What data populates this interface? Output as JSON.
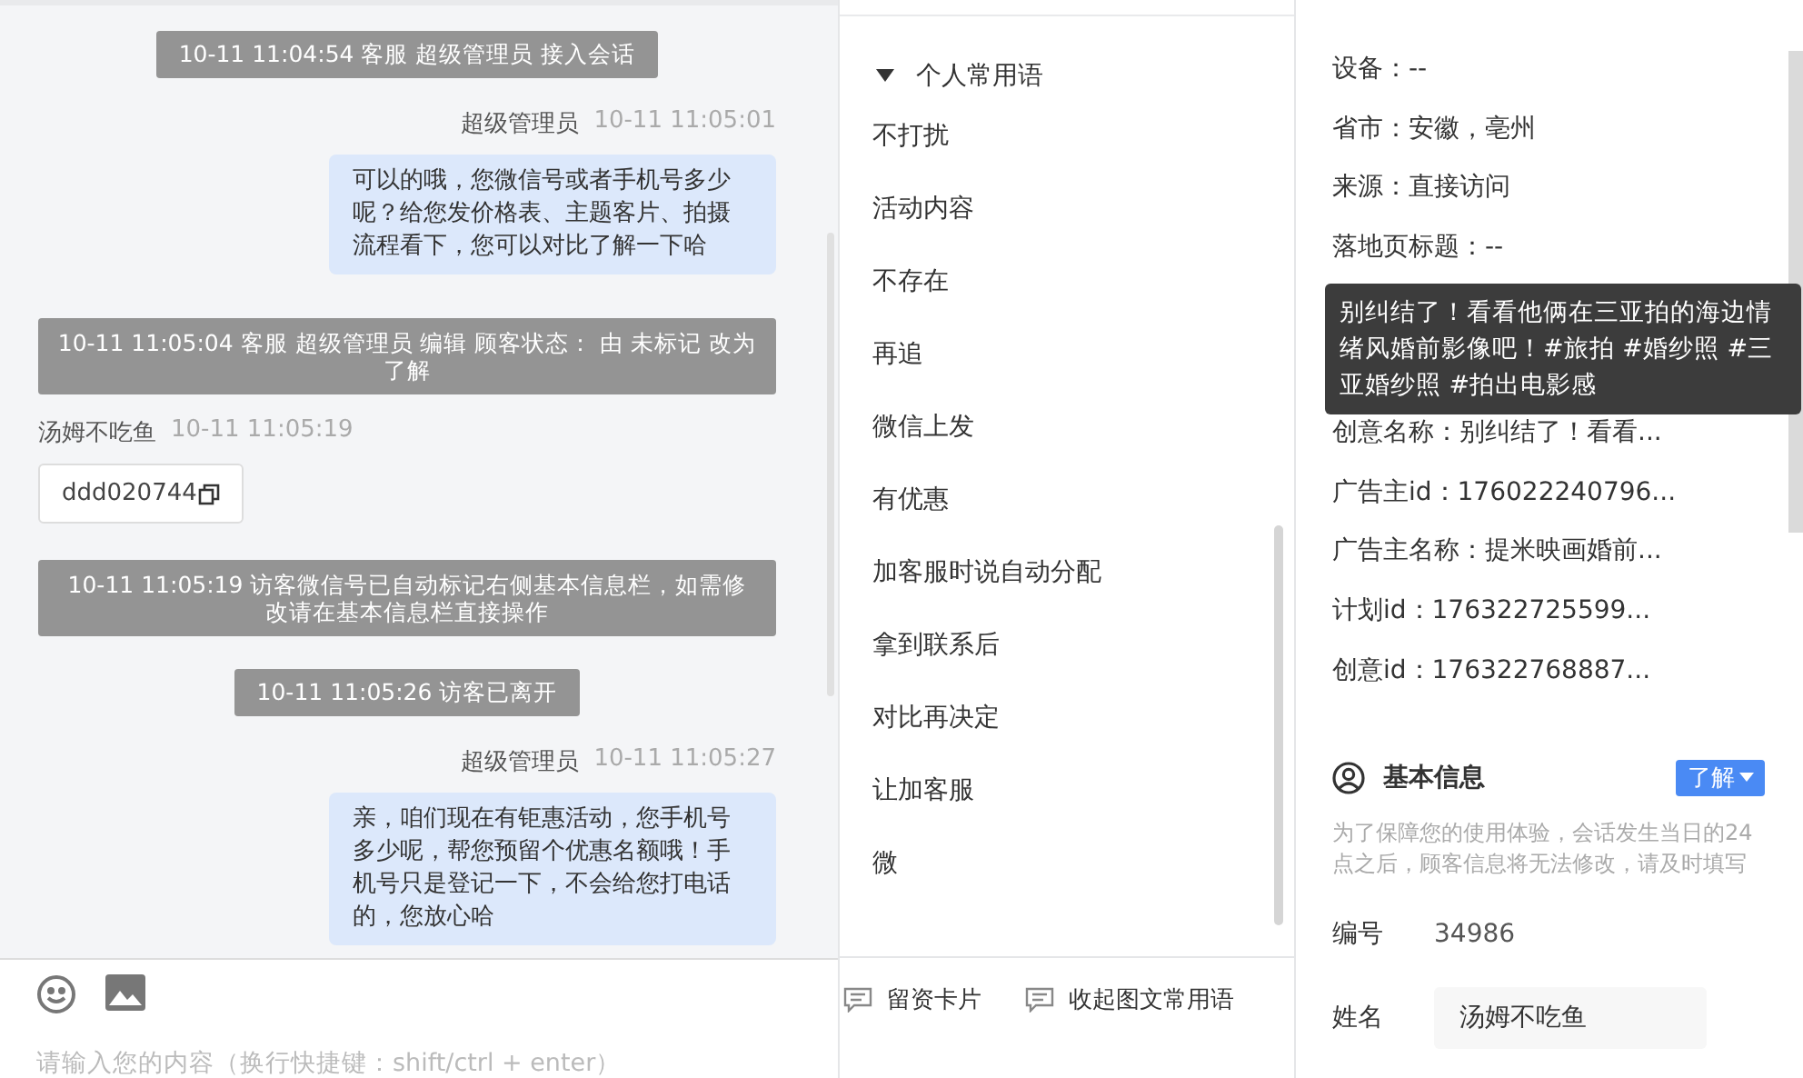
{
  "chat": {
    "messages": [
      {
        "kind": "system",
        "text": "10-11 11:04:54 客服 超级管理员 接入会话"
      },
      {
        "kind": "agent",
        "sender": "超级管理员",
        "time": "10-11 11:05:01",
        "text": "可以的哦，您微信号或者手机号多少呢？给您发价格表、主题客片、拍摄流程看下，您可以对比了解一下哈"
      },
      {
        "kind": "system_wide",
        "text": "10-11 11:05:04 客服 超级管理员 编辑 顾客状态： 由 未标记 改为了解"
      },
      {
        "kind": "visitor",
        "sender": "汤姆不吃鱼",
        "time": "10-11 11:05:19",
        "text": "ddd020744"
      },
      {
        "kind": "system_wide",
        "text": "10-11 11:05:19 访客微信号已自动标记右侧基本信息栏，如需修改请在基本信息栏直接操作"
      },
      {
        "kind": "system",
        "text": "10-11 11:05:26 访客已离开"
      },
      {
        "kind": "agent",
        "sender": "超级管理员",
        "time": "10-11 11:05:27",
        "text": "亲，咱们现在有钜惠活动，您手机号多少呢，帮您预留个优惠名额哦！手机号只是登记一下，不会给您打电话的，您放心哈"
      }
    ],
    "input_placeholder": "请输入您的内容（换行快捷键：shift/ctrl + enter）"
  },
  "phrases": {
    "group": {
      "label": "个人常用语",
      "expanded": true
    },
    "items": [
      "不打扰",
      "活动内容",
      "不存在",
      "再追",
      "微信上发",
      "有优惠",
      "加客服时说自动分配",
      "拿到联系后",
      "对比再决定",
      "让加客服",
      "微"
    ],
    "actions": [
      "留资卡片",
      "收起图文常用语"
    ]
  },
  "source_info": {
    "fields": [
      "设备：--",
      "省市：安徽，亳州",
      "来源：直接访问",
      "落地页标题：--"
    ],
    "tooltip": "别纠结了！看看他俩在三亚拍的海边情绪风婚前影像吧！#旅拍 #婚纱照 #三亚婚纱照 #拍出电影感",
    "fields_after": [
      "创意名称：别纠结了！看看...",
      "广告主id：176022240796...",
      "广告主名称：提米映画婚前...",
      "计划id：176322725599...",
      "创意id：176322768887..."
    ]
  },
  "basic_info": {
    "title": "基本信息",
    "status": "了解",
    "notice": "为了保障您的使用体验，会话发生当日的24点之后，顾客信息将无法修改，请及时填写",
    "fields": [
      {
        "kind": "text",
        "label": "编号",
        "value": "34986"
      },
      {
        "kind": "input",
        "label": "姓名",
        "value": "汤姆不吃鱼"
      }
    ]
  }
}
